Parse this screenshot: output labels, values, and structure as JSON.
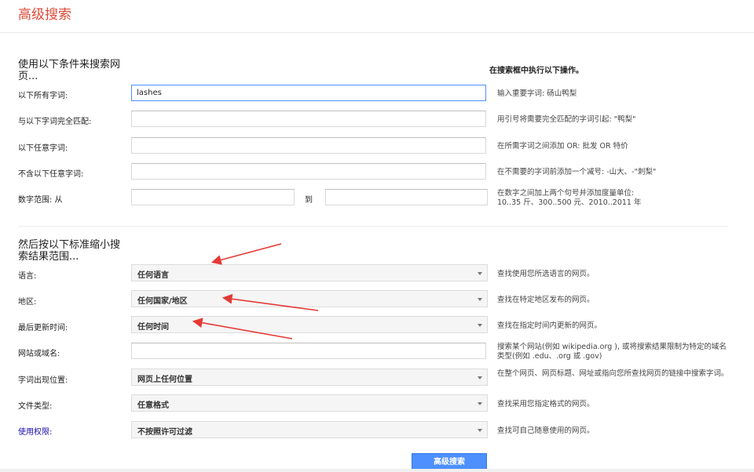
{
  "header": {
    "title": "高级搜索"
  },
  "section1": {
    "title": "使用以下条件来搜索网页...",
    "hint_head": "在搜索框中执行以下操作。",
    "rows": [
      {
        "label": "以下所有字词:",
        "value": "lashes",
        "hint": "输入重要字词: 砀山鸭梨"
      },
      {
        "label": "与以下字词完全匹配:",
        "value": "",
        "hint": "用引号将需要完全匹配的字词引起: \"鸭梨\""
      },
      {
        "label": "以下任意字词:",
        "value": "",
        "hint": "在所需字词之间添加 OR: 批发 OR 特价"
      },
      {
        "label": "不含以下任意字词:",
        "value": "",
        "hint": "在不需要的字词前添加一个减号: -山大、-\"刺梨\""
      }
    ],
    "range": {
      "label": "数字范围: 从",
      "to_label": "到",
      "hint": "在数字之间加上两个句号并添加度量单位: 10..35 斤、300..500 元、2010..2011 年"
    }
  },
  "section2": {
    "title": "然后按以下标准缩小搜索结果范围...",
    "rows": [
      {
        "label": "语言:",
        "value": "任何语言",
        "hint": "查找使用您所选语言的网页。"
      },
      {
        "label": "地区:",
        "value": "任何国家/地区",
        "hint": "查找在特定地区发布的网页。"
      },
      {
        "label": "最后更新时间:",
        "value": "任何时间",
        "hint": "查找在指定时间内更新的网页。"
      },
      {
        "label": "网站或域名:",
        "value": "",
        "hint": "搜索某个网站(例如 wikipedia.org ), 或将搜索结果限制为特定的域名类型(例如 .edu、.org 或 .gov)"
      },
      {
        "label": "字词出现位置:",
        "value": "网页上任何位置",
        "hint": "在整个网页、网页标题、网址或指向您所查找网页的链接中搜索字词。"
      },
      {
        "label": "文件类型:",
        "value": "任意格式",
        "hint": "查找采用您指定格式的网页。"
      },
      {
        "label": "使用权限:",
        "value": "不按照许可过滤",
        "hint": "查找可自己随意使用的网页。"
      }
    ]
  },
  "submit": {
    "label": "高级搜索"
  },
  "colors": {
    "title": "#dd4b39",
    "button": "#4d90fe",
    "annotation": "#e53935",
    "link": "#1a0dab"
  }
}
